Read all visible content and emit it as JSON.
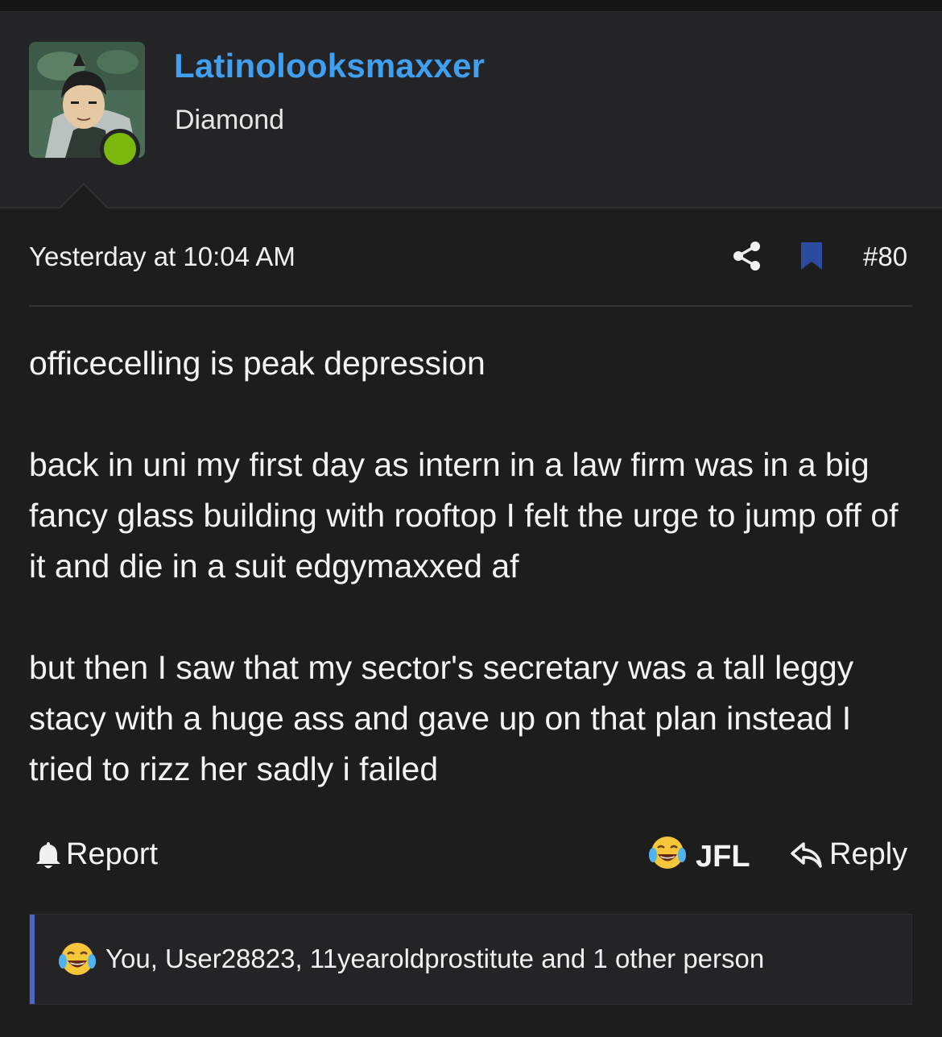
{
  "user": {
    "username": "Latinolooksmaxxer",
    "title": "Diamond",
    "status_color": "#7ab80e"
  },
  "meta": {
    "timestamp": "Yesterday at 10:04 AM",
    "post_number": "#80",
    "share_icon": "share-icon",
    "bookmark_icon": "bookmark-icon"
  },
  "post": {
    "paragraphs": [
      "officecelling is peak depression",
      "back in uni my first day as intern in a law firm was in a big fancy glass building with rooftop I felt the urge to jump off of it and die in a suit edgymaxxed af",
      "but then I saw that my sector's secretary was a tall leggy stacy with a huge ass and gave up on that plan instead I tried to rizz her sadly i failed"
    ]
  },
  "actions": {
    "report_label": "Report",
    "reaction_label": "JFL",
    "reply_label": "Reply"
  },
  "reactions": {
    "summary": "You, User28823, 11yearoldprostitute and 1 other person"
  },
  "colors": {
    "accent_blue": "#3f9ff0",
    "bookmark": "#2c4a9e",
    "reaction_bar_accent": "#4f64c7",
    "background": "#1d1d1e"
  }
}
